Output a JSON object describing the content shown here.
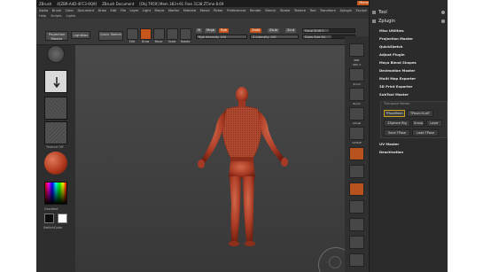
{
  "titlebar": {
    "app": "ZBrush",
    "version": "4[ZBR-A4D-4FC3-9Q9]",
    "doc": "ZBrush Document",
    "stats": "[Obj 7959]  Mem 383+91  Free 3138  ZTime 8.69",
    "ac_button": "Menus",
    "script_label": "DefaultZScript"
  },
  "menu": {
    "row1": [
      "Alpha",
      "Brush",
      "Color",
      "Document",
      "Draw",
      "Edit",
      "File",
      "Layer",
      "Light",
      "Macro",
      "Marker",
      "Material",
      "Movie",
      "Picker",
      "Preferences",
      "Render",
      "Stencil",
      "Stroke",
      "Texture",
      "Tool",
      "Transform",
      "Zplugin",
      "Zscript"
    ],
    "row2": [
      "Help",
      "Scripts",
      "Lights"
    ]
  },
  "shelf": {
    "projection_master": "Projection Master",
    "lightbox": "LightBox",
    "quick_sketch": "Quick Sketch",
    "edit": "Edit",
    "draw": "Draw",
    "move": "Move",
    "scale": "Scale",
    "rotate": "Rotate",
    "rgb": "Rgb",
    "m": "M",
    "mrgb": "Mrgb",
    "zadd": "Zadd",
    "zsub": "Zsub",
    "zcut": "Zcut",
    "rgb_intensity": "Rgb Intensity 100",
    "z_intensity": "Z Intensity 100",
    "focal_shift": "Focal Shift 0",
    "draw_size": "Draw Size 64"
  },
  "left_tray": {
    "texture_off": "Texture Off",
    "gradient": "Gradient",
    "switch_color": "SwitchColor"
  },
  "right_column": {
    "labels": [
      "BPR",
      "SPix 3",
      "Scroll",
      "Zoom",
      "Actual",
      "AAHalf",
      "Persp",
      "Floor",
      "Local",
      "LSym",
      "Gxyz",
      "Frame",
      "Move",
      "Scale",
      "Rotate",
      "PolyF",
      "Transp",
      "Ghost",
      "Solo",
      "Xpose"
    ]
  },
  "palette": {
    "tool_title": "Tool",
    "zplugin_title": "Zplugin",
    "items": [
      "Misc Utilities",
      "Projection Master",
      "QuickSketch",
      "Adjust Plugin",
      "Maya Blend Shapes",
      "Decimation Master",
      "Multi Map Exporter",
      "3D Print Exporter",
      "SubTool Master"
    ],
    "transpose_master": "Transpose Master",
    "tm_buttons": [
      "TPoseMesh",
      "TPose>SubT",
      "ZSphere Rig",
      "Layer"
    ],
    "tm_buttons2": [
      "Save TPose",
      "Load TPose"
    ],
    "tm_row3": [
      "TPose",
      "Group"
    ],
    "items2": [
      "UV Master",
      "Deactivation"
    ]
  },
  "colors": {
    "accent_orange": "#c7561c",
    "model_red": "#b5442c",
    "panel_bg": "#2b2b2b"
  }
}
